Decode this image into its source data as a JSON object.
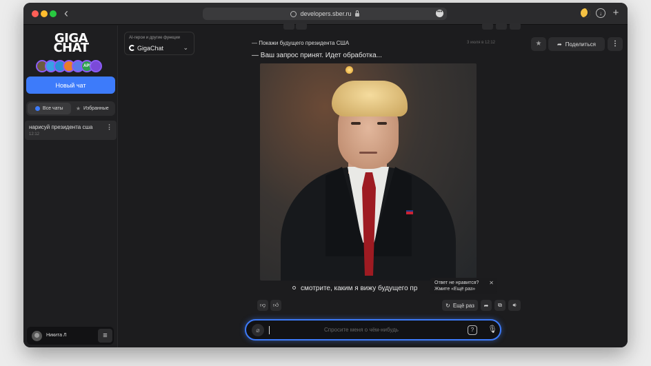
{
  "browser": {
    "url": "developers.sber.ru",
    "back_icon": "chevron-left-icon",
    "menu_glyph": "•••"
  },
  "sidebar": {
    "logo_line1": "GIGA",
    "logo_line2": "CHAT",
    "avatar_badge": "API",
    "new_chat_label": "Новый чат",
    "filter_all": "Все чаты",
    "filter_favorites": "Избранные",
    "chat_items": [
      {
        "title": "нарисуй президента сша",
        "time": "12:12"
      }
    ],
    "user_name": "Никита Л"
  },
  "header": {
    "model_caption": "AI-герои и другие функции",
    "model_name": "GigaChat",
    "share_label": "Поделиться"
  },
  "conversation": {
    "user_message": "— Покажи будущего президента США",
    "date": "3 июля в 12:12",
    "status": "— Ваш запрос принят. Идет обработка...",
    "bullet_text": "смотрите, каким я вижу будущего пр",
    "retry_label": "Ещё раз"
  },
  "tooltip": {
    "line1": "Ответ не нравится?",
    "line2": "Жмите «Ещё раз»"
  },
  "input": {
    "placeholder": "Спросите меня о чём-нибудь"
  },
  "colors": {
    "accent": "#3d7bfa",
    "background": "#1c1c1e",
    "sidebar": "#1e1e20"
  }
}
